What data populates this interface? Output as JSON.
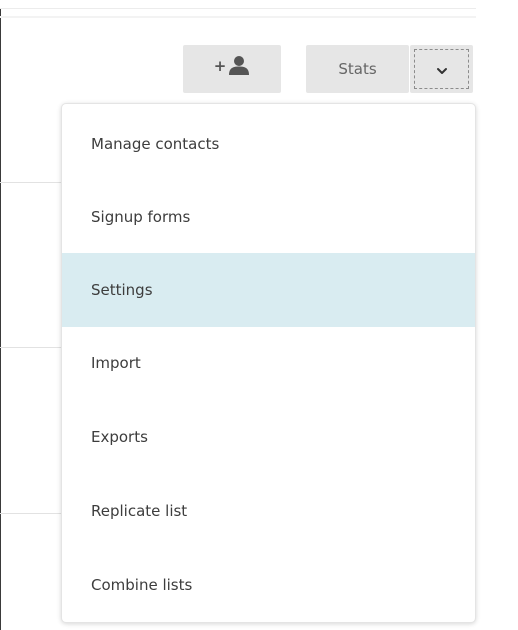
{
  "toolbar": {
    "add_contact_plus": "+",
    "add_contact_icon": "person-icon",
    "stats_label": "Stats",
    "dropdown_icon": "chevron-down-icon"
  },
  "menu": {
    "items": [
      {
        "label": "Manage contacts",
        "highlighted": false
      },
      {
        "label": "Signup forms",
        "highlighted": false
      },
      {
        "label": "Settings",
        "highlighted": true
      },
      {
        "label": "Import",
        "highlighted": false
      },
      {
        "label": "Exports",
        "highlighted": false
      },
      {
        "label": "Replicate list",
        "highlighted": false
      },
      {
        "label": "Combine lists",
        "highlighted": false
      }
    ]
  },
  "colors": {
    "highlight": "#d9ecf1",
    "button_bg": "#e6e6e6",
    "text": "#3d3d3d"
  }
}
